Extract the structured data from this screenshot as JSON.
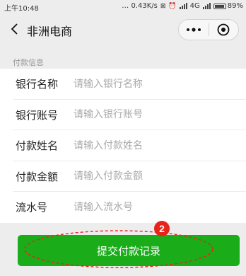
{
  "status_bar": {
    "time": "上午10:48",
    "indicators": "… 0.43K/s",
    "network": "4G",
    "battery": "89%"
  },
  "nav": {
    "title": "非洲电商",
    "back_icon": "chevron-left-icon",
    "more_icon": "more-dots-icon",
    "close_icon": "target-circle-icon"
  },
  "section": {
    "title": "付款信息"
  },
  "form": {
    "fields": [
      {
        "label": "银行名称",
        "placeholder": "请输入银行名称",
        "value": ""
      },
      {
        "label": "银行账号",
        "placeholder": "请输入银行账号",
        "value": ""
      },
      {
        "label": "付款姓名",
        "placeholder": "请输入付款姓名",
        "value": ""
      },
      {
        "label": "付款金额",
        "placeholder": "请输入付款金额",
        "value": ""
      },
      {
        "label": "流水号",
        "placeholder": "请输入流水号",
        "value": ""
      }
    ]
  },
  "submit": {
    "label": "提交付款记录"
  },
  "annotation": {
    "badge_number": "2",
    "color": "#e8231a"
  },
  "colors": {
    "primary_button": "#1aad19",
    "background": "#ededed"
  }
}
